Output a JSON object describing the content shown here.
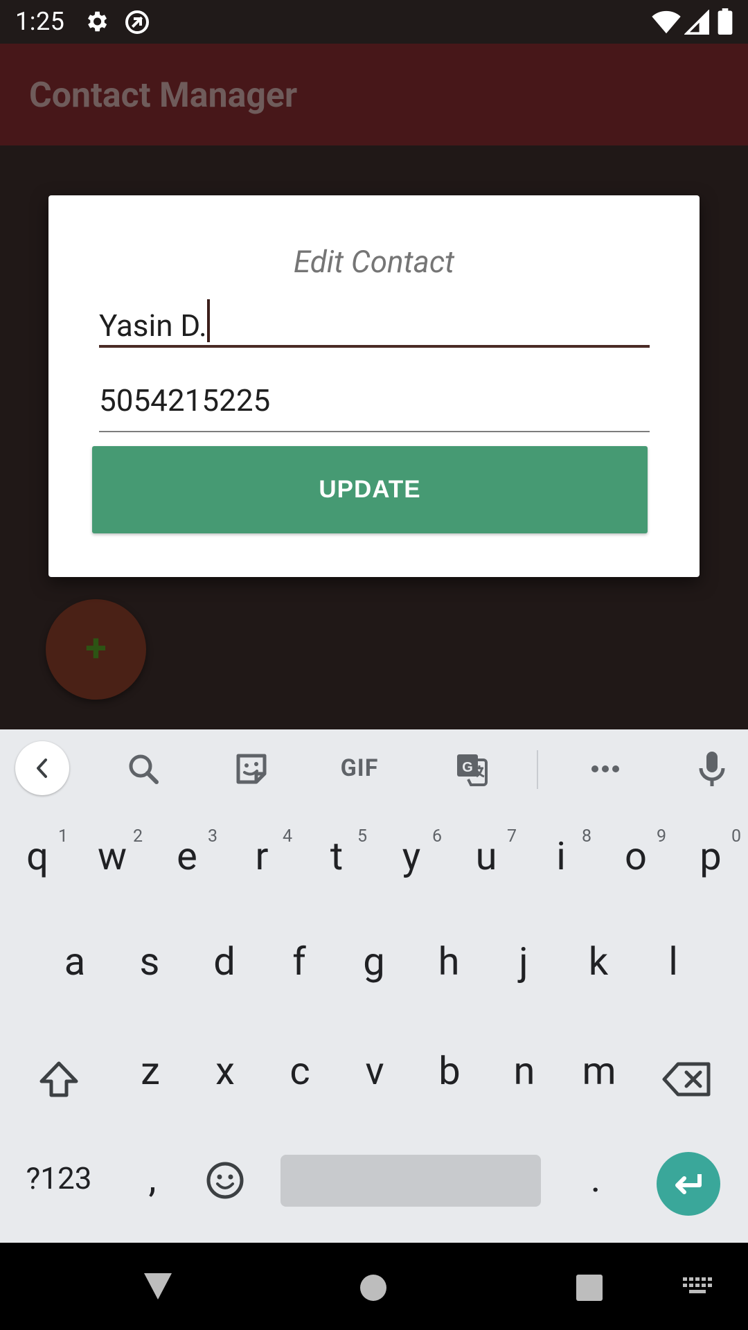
{
  "status_bar": {
    "time": "1:25"
  },
  "app_bar": {
    "title": "Contact Manager"
  },
  "dialog": {
    "title": "Edit Contact",
    "name_value": "Yasin D.",
    "phone_value": "5054215225",
    "update_label": "UPDATE"
  },
  "fab": {
    "label": "+"
  },
  "keyboard": {
    "row1": [
      {
        "k": "q",
        "h": "1"
      },
      {
        "k": "w",
        "h": "2"
      },
      {
        "k": "e",
        "h": "3"
      },
      {
        "k": "r",
        "h": "4"
      },
      {
        "k": "t",
        "h": "5"
      },
      {
        "k": "y",
        "h": "6"
      },
      {
        "k": "u",
        "h": "7"
      },
      {
        "k": "i",
        "h": "8"
      },
      {
        "k": "o",
        "h": "9"
      },
      {
        "k": "p",
        "h": "0"
      }
    ],
    "row2": [
      "a",
      "s",
      "d",
      "f",
      "g",
      "h",
      "j",
      "k",
      "l"
    ],
    "row3": [
      "z",
      "x",
      "c",
      "v",
      "b",
      "n",
      "m"
    ],
    "symbols_label": "?123",
    "comma": ",",
    "period": ".",
    "gif_label": "GIF"
  }
}
